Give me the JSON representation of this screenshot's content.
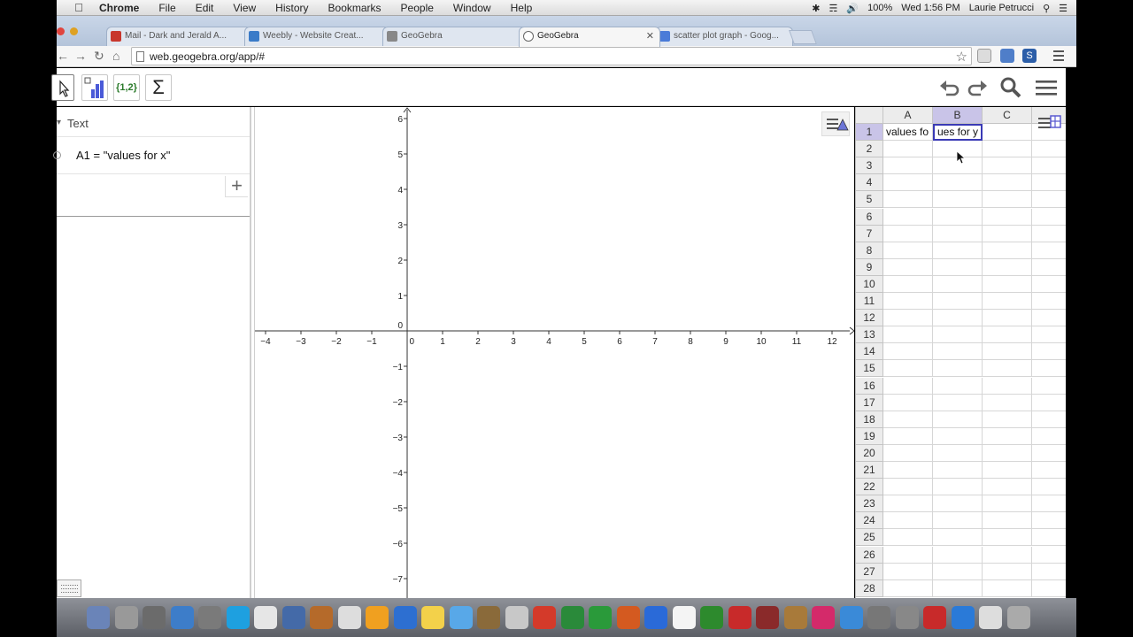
{
  "macmenu": {
    "app": "Chrome",
    "items": [
      "File",
      "Edit",
      "View",
      "History",
      "Bookmarks",
      "People",
      "Window",
      "Help"
    ],
    "battery": "100%",
    "clock": "Wed 1:56 PM",
    "user": "Laurie Petrucci"
  },
  "browser": {
    "tabs": [
      {
        "label": "Mail - Dark and Jerald A...",
        "favicon_color": "#c8372d"
      },
      {
        "label": "Weebly - Website Creat...",
        "favicon_color": "#3a7bc8"
      },
      {
        "label": "GeoGebra",
        "favicon_color": "#777777"
      },
      {
        "label": "GeoGebra",
        "favicon_color": "#777777",
        "active": true
      },
      {
        "label": "scatter plot graph - Goog...",
        "favicon_color": "#4a7bd8"
      }
    ],
    "url": "web.geogebra.org/app/#"
  },
  "ggb_toolbar": {
    "list_tool_label": "{1,2}",
    "sum_tool_label": "Σ"
  },
  "algebra": {
    "category": "Text",
    "items": [
      {
        "text": "A1 = \"values for x\""
      }
    ],
    "input_placeholder": ""
  },
  "graphics": {
    "x_ticks": [
      "−4",
      "−3",
      "−2",
      "−1",
      "0",
      "1",
      "2",
      "3",
      "4",
      "5",
      "6",
      "7",
      "8",
      "9",
      "10",
      "11",
      "12"
    ],
    "y_ticks_pos": [
      "6",
      "5",
      "4",
      "3",
      "2",
      "1",
      "0"
    ],
    "y_ticks_neg": [
      "−1",
      "−2",
      "−3",
      "−4",
      "−5",
      "−6",
      "−7"
    ]
  },
  "spreadsheet": {
    "columns": [
      "A",
      "B",
      "C"
    ],
    "rows": [
      "1",
      "2",
      "3",
      "4",
      "5",
      "6",
      "7",
      "8",
      "9",
      "10",
      "11",
      "12",
      "13",
      "14",
      "15",
      "16",
      "17",
      "18",
      "19",
      "20",
      "21",
      "22",
      "23",
      "24",
      "25",
      "26",
      "27",
      "28"
    ],
    "cell_A1": "values fo",
    "cell_B1_editing": "ues for y"
  },
  "colors": {
    "accent": "#3a3ab5",
    "selection": "#c9c4e8",
    "geogebra_green": "#2a7a2a"
  }
}
